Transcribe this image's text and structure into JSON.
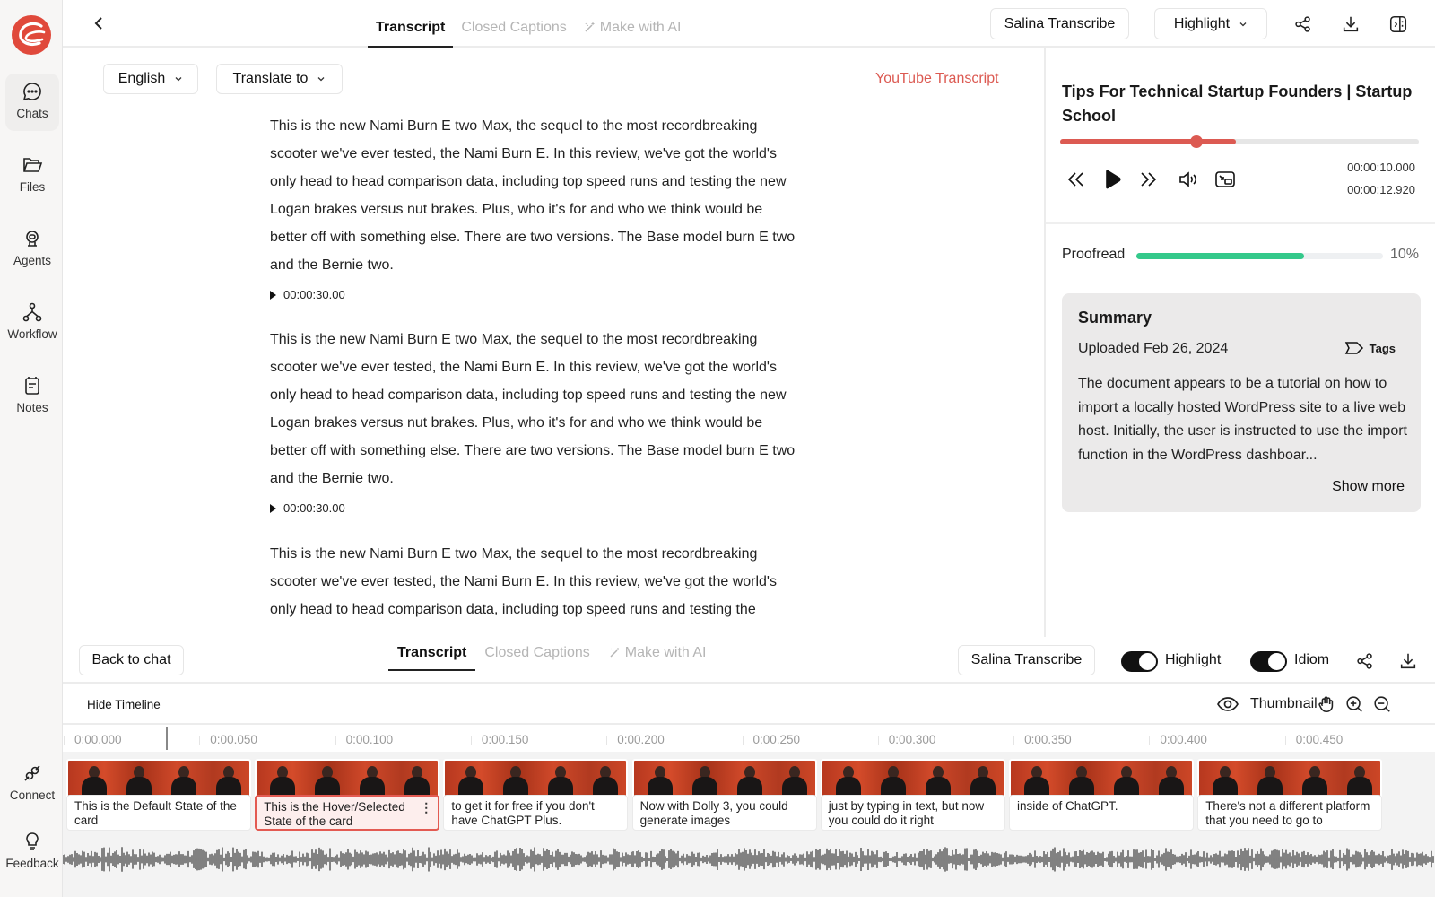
{
  "sidebar": {
    "items": [
      {
        "label": "Chats",
        "icon": "chat-bubble-icon",
        "active": true
      },
      {
        "label": "Files",
        "icon": "folder-icon",
        "active": false
      },
      {
        "label": "Agents",
        "icon": "agent-icon",
        "active": false
      },
      {
        "label": "Workflow",
        "icon": "workflow-icon",
        "active": false
      },
      {
        "label": "Notes",
        "icon": "notes-icon",
        "active": false
      }
    ],
    "bottom_items": [
      {
        "label": "Connect",
        "icon": "connect-plug-icon"
      },
      {
        "label": "Feedback",
        "icon": "lightbulb-icon"
      }
    ]
  },
  "topbar": {
    "tabs": [
      {
        "label": "Transcript",
        "active": true
      },
      {
        "label": "Closed Captions",
        "active": false
      },
      {
        "label": "Make with AI",
        "active": false,
        "icon": "magic-wand-icon"
      }
    ],
    "transcribe_button": "Salina Transcribe",
    "highlight_dropdown": "Highlight"
  },
  "main": {
    "language_dropdown": "English",
    "translate_dropdown": "Translate to",
    "youtube_link": "YouTube Transcript",
    "segments": [
      {
        "text": "This is the new Nami Burn E two Max, the sequel to the most recordbreaking scooter we've ever tested, the Nami Burn E. In this review, we've got the world's only head to head comparison data, including top speed runs and testing the new Logan brakes versus nut brakes. Plus, who it's for and who we think would be better off with something else. There are two versions. The Base model burn E two and the Bernie two.",
        "timestamp": "00:00:30.00"
      },
      {
        "text": "This is the new Nami Burn E two Max, the sequel to the most recordbreaking scooter we've ever tested, the Nami Burn E. In this review, we've got the world's only head to head comparison data, including top speed runs and testing the new Logan brakes versus nut brakes. Plus, who it's for and who we think would be better off with something else. There are two versions. The Base model burn E two and the Bernie two.",
        "timestamp": "00:00:30.00"
      },
      {
        "text": "This is the new Nami Burn E two Max, the sequel to the most recordbreaking scooter we've ever tested, the Nami Burn E. In this review, we've got the world's only head to head comparison data, including top speed runs and testing the",
        "timestamp": ""
      }
    ]
  },
  "player": {
    "title": "Tips For Technical Startup Founders | Startup School",
    "progress_fraction": 0.49,
    "knob_fraction": 0.38,
    "current_time": "00:00:10.000",
    "total_time": "00:00:12.920"
  },
  "proofread": {
    "label": "Proofread",
    "bar_fraction": 0.68,
    "percent_label": "10%"
  },
  "summary": {
    "title": "Summary",
    "uploaded": "Uploaded Feb 26, 2024",
    "tags_label": "Tags",
    "text": "The document appears to be a tutorial on how to import a locally hosted WordPress site to a live web host. Initially, the user is instructed to use the import function in the WordPress dashboar...",
    "show_more": "Show more"
  },
  "bottombar": {
    "back_button": "Back to chat",
    "tabs": [
      {
        "label": "Transcript",
        "active": true
      },
      {
        "label": "Closed Captions",
        "active": false
      },
      {
        "label": "Make with AI",
        "active": false
      }
    ],
    "transcribe_button": "Salina Transcribe",
    "highlight_toggle": {
      "label": "Highlight",
      "on": true
    },
    "idiom_toggle": {
      "label": "Idiom",
      "on": true
    }
  },
  "timeline": {
    "hide_label": "Hide Timeline",
    "thumbnail_label": "Thumbnail",
    "ticks": [
      "0:00.000",
      "0:00.050",
      "0:00.100",
      "0:00.150",
      "0:00.200",
      "0:00.250",
      "0:00.300",
      "0:00.350",
      "0:00.400",
      "0:00.450"
    ],
    "clips": [
      {
        "caption": "This is the Default State of the card",
        "selected": false
      },
      {
        "caption": "This is the Hover/Selected State of the card",
        "selected": true
      },
      {
        "caption": "to get it for free if you don't have ChatGPT Plus.",
        "selected": false
      },
      {
        "caption": "Now with Dolly 3, you could generate images",
        "selected": false
      },
      {
        "caption": "just by typing in text,  but now you could do it right",
        "selected": false
      },
      {
        "caption": "inside of ChatGPT.",
        "selected": false
      },
      {
        "caption": " There's not a different platform that you need to go to",
        "selected": false
      }
    ]
  },
  "colors": {
    "accent": "#dc5a52",
    "proofread": "#34c98b"
  }
}
